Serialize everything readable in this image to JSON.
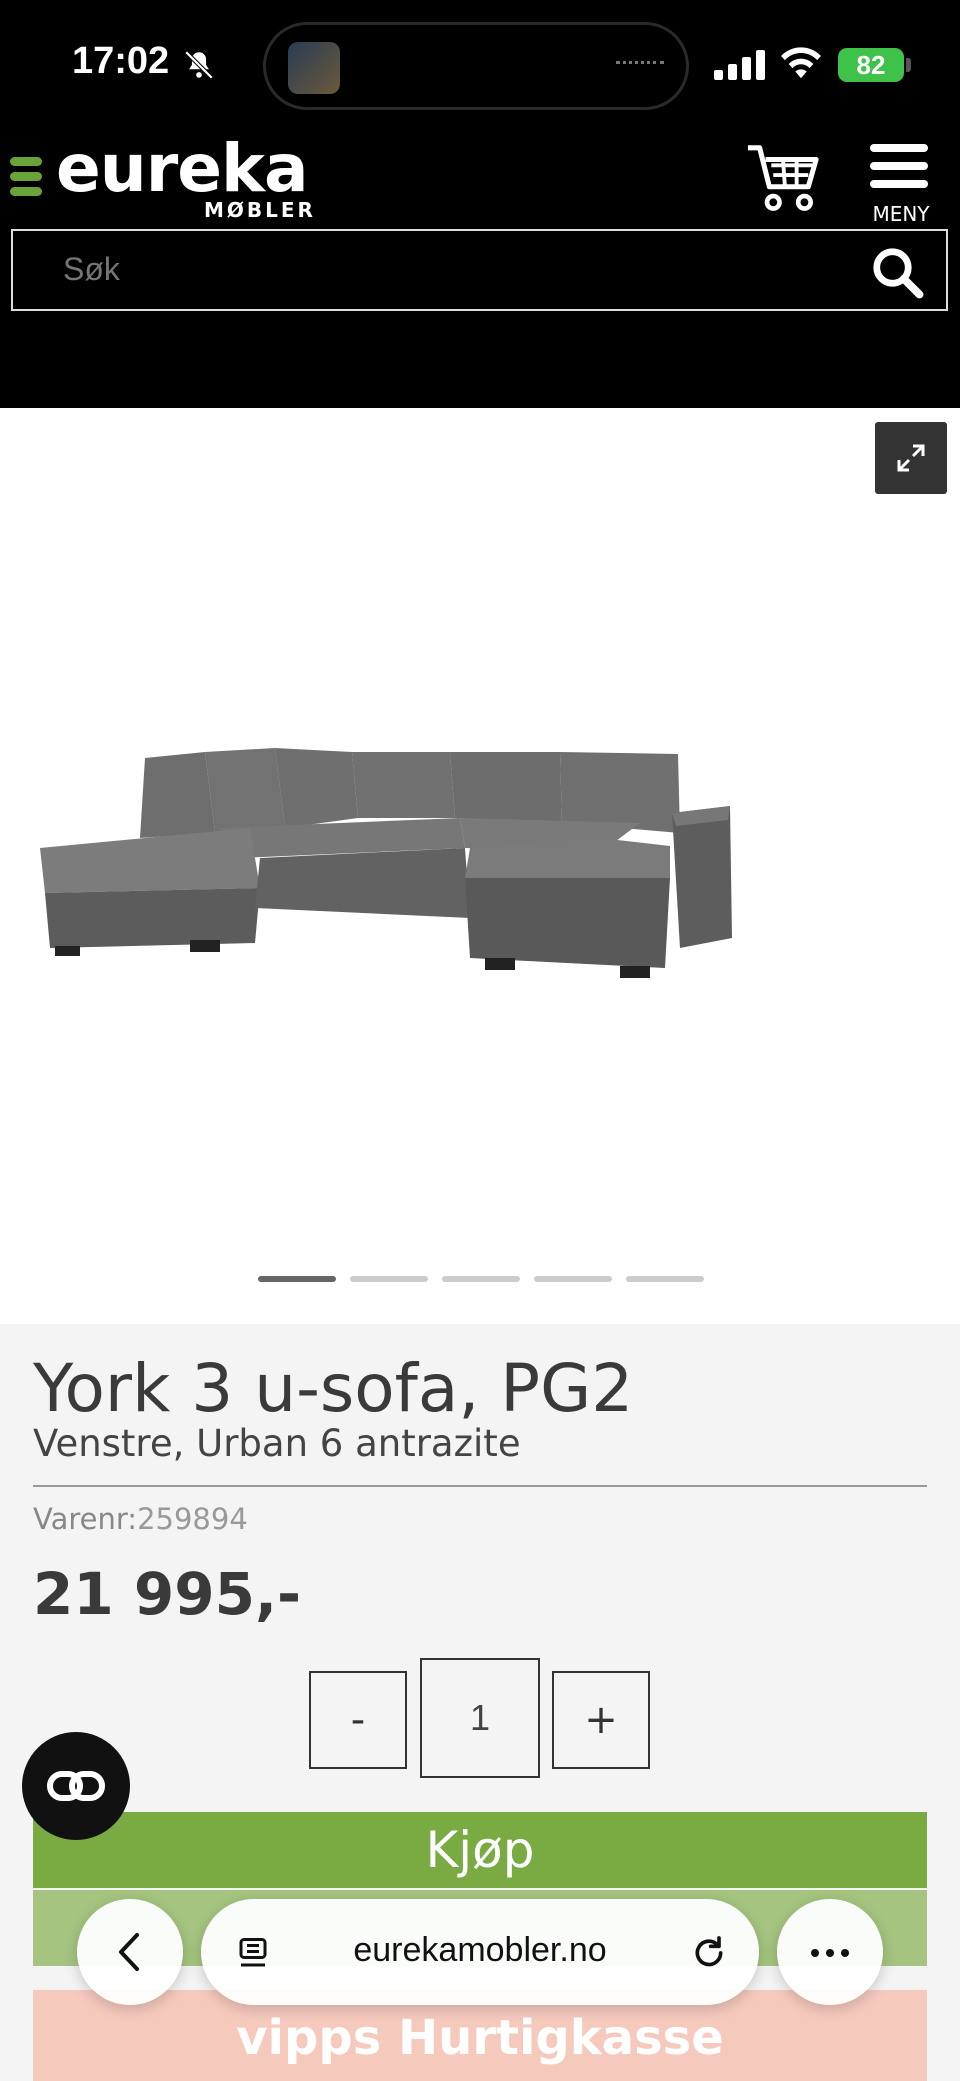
{
  "status_bar": {
    "time": "17:02",
    "battery": "82",
    "icons": [
      "bell-slash-icon",
      "signal-icon",
      "wifi-icon",
      "battery-icon"
    ]
  },
  "header": {
    "logo_main": "eureka",
    "logo_sub": "MØBLER",
    "menu_label": "MENY",
    "search_placeholder": "Søk",
    "colors": {
      "background": "#000000",
      "logo_accent": "#6aa33a"
    }
  },
  "gallery": {
    "image_count": 5,
    "active_index": 0
  },
  "product": {
    "title": "York 3 u-sofa, PG2",
    "subtitle": "Venstre, Urban 6 antrazite",
    "sku_label": "Varenr:",
    "sku": "259894",
    "price": "21 995,-",
    "quantity": "1",
    "minus_label": "-",
    "plus_label": "+",
    "buy_label": "Kjøp",
    "vipps_logo": "vipps",
    "vipps_label": "Hurtigkasse",
    "colors": {
      "buy": "#79ab42",
      "vipps": "#f6c9bd"
    }
  },
  "browser": {
    "url": "eurekamobler.no"
  }
}
